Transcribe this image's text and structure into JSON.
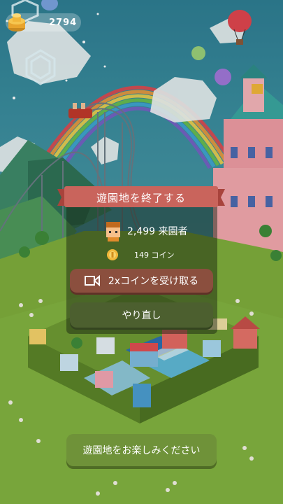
{
  "hud": {
    "coin_count": "2794",
    "coin_icon": "coin-stack-icon"
  },
  "modal": {
    "title": "遊園地を終了する",
    "visitors_text": "2,499 来園者",
    "visitor_icon": "visitor-avatar-icon",
    "coins_text": "149 コイン",
    "coin_icon": "coin-icon",
    "double_button_label": "2xコインを受け取る",
    "double_button_icon": "video-icon",
    "retry_button_label": "やり直し"
  },
  "bottom": {
    "enjoy_button_label": "遊園地をお楽しみください"
  },
  "colors": {
    "ribbon": "#c9645c",
    "double_button": "#8b4f3e",
    "retry_button": "#4c5f2f",
    "enjoy_button": "#6f9239",
    "coin_gold": "#f2b73a"
  }
}
